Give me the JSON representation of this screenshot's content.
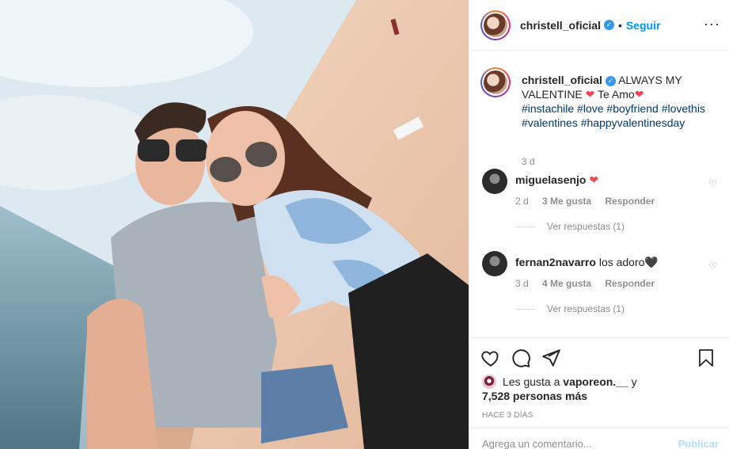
{
  "post": {
    "username": "christell_oficial",
    "follow_label": "Seguir",
    "separator": "•",
    "more_label": "···"
  },
  "caption": {
    "username": "christell_oficial",
    "text_part1": "ALWAYS MY VALENTINE",
    "text_part2": "Te Amo",
    "hashtags": [
      "#instachile",
      "#love",
      "#boyfriend",
      "#lovethis",
      "#valentines",
      "#happyvalentinesday"
    ],
    "time": "3 d"
  },
  "comments": [
    {
      "username": "miguelasenjo",
      "text": "",
      "emoji": "❤",
      "time": "2 d",
      "likes": "3 Me gusta",
      "reply": "Responder",
      "view_replies": "Ver respuestas (1)"
    },
    {
      "username": "fernan2navarro",
      "text": "los adoro",
      "emoji": "🖤",
      "time": "3 d",
      "likes": "4 Me gusta",
      "reply": "Responder",
      "view_replies": "Ver respuestas (1)"
    }
  ],
  "likes": {
    "prefix": "Les gusta a",
    "user": "vaporeon.__",
    "conj": "y",
    "count": "7,528 personas más"
  },
  "posted_ago": "HACE 3 DÍAS",
  "add_comment": {
    "placeholder": "Agrega un comentario...",
    "publish": "Publicar"
  },
  "icons": [
    "heart-icon",
    "comment-icon",
    "share-icon",
    "bookmark-icon",
    "verified-icon",
    "more-icon"
  ],
  "colors": {
    "accent": "#0095f6",
    "heart": "#ed4956",
    "hashtag": "#00376b",
    "muted": "#8e8e8e"
  }
}
